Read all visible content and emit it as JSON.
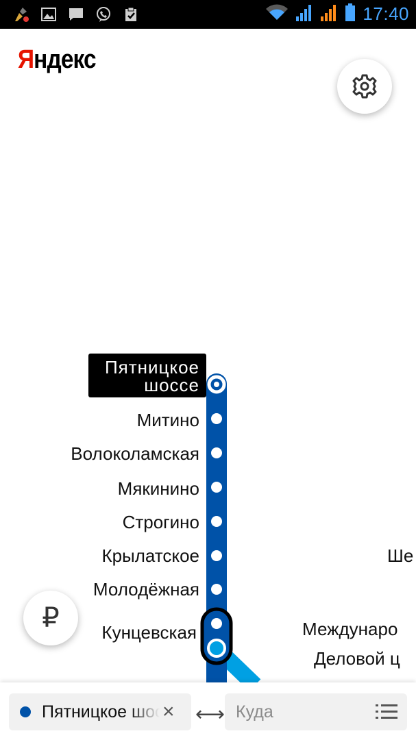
{
  "status_bar": {
    "time": "17:40",
    "left_icons": [
      "broom-icon",
      "image-icon",
      "message-icon",
      "viber-icon",
      "clipboard-check-icon"
    ],
    "right_icons": [
      "wifi-icon",
      "signal-icon",
      "signal-icon",
      "battery-icon"
    ]
  },
  "header": {
    "logo_first": "Я",
    "logo_rest": "ндекс"
  },
  "buttons": {
    "settings_icon": "gear-icon",
    "fare_icon": "ruble-icon",
    "fare_glyph": "₽"
  },
  "map": {
    "line_color": "#0052a8",
    "line2_color": "#00a0e3",
    "selected_station": {
      "line1": "Пятницкое",
      "line2": "шоссе"
    },
    "stations": [
      "Митино",
      "Волоколамская",
      "Мякинино",
      "Строгино",
      "Крылатское",
      "Молодёжная",
      "Кунцевская"
    ],
    "right_labels": [
      "Ше",
      "Междунаро",
      "Деловой ц"
    ]
  },
  "route": {
    "from_value": "Пятницкое шоссе",
    "clear_glyph": "×",
    "swap_glyph": "⟷",
    "to_placeholder": "Куда"
  },
  "colors": {
    "accent": "#48a6ff",
    "brand_red": "#e61400"
  }
}
